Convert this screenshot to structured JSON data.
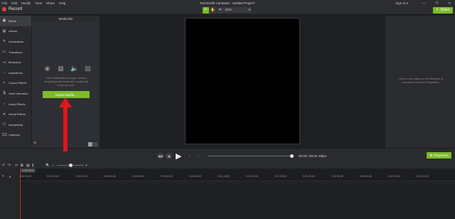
{
  "menubar": {
    "items": [
      "File",
      "Edit",
      "Modify",
      "View",
      "Share",
      "Help"
    ],
    "window_title": "TechSmith Camtasia - Untitled Project*",
    "sign_in": "Sign in ▾",
    "min_glyph": "—",
    "max_glyph": "❐",
    "close_glyph": "✕"
  },
  "toolbar": {
    "record_label": "Record",
    "zoom_value": "63%",
    "share_label": "Share"
  },
  "nav": {
    "items": [
      {
        "label": "Media",
        "icon": "▣"
      },
      {
        "label": "Library",
        "icon": "▤"
      },
      {
        "label": "Annotations",
        "icon": "✎"
      },
      {
        "label": "Transitions",
        "icon": "▭"
      },
      {
        "label": "Behaviors",
        "icon": "↝"
      },
      {
        "label": "Animations",
        "icon": "→"
      },
      {
        "label": "Cursor Effects",
        "icon": "↖"
      },
      {
        "label": "Voice Narration",
        "icon": "🎙"
      },
      {
        "label": "Audio Effects",
        "icon": "♪"
      },
      {
        "label": "Visual Effects",
        "icon": "✦"
      },
      {
        "label": "Interactivity",
        "icon": "☐"
      },
      {
        "label": "Captions",
        "icon": "CC"
      }
    ]
  },
  "media_bin": {
    "title": "Media Bin",
    "empty_text": "Your Media Bin is empty. Screen recordings and imported media will show up here.",
    "import_button": "Import Media...",
    "add_glyph": "+"
  },
  "properties": {
    "empty_text": "Click on an object on the timeline or canvas to show its Properties.",
    "button_label": "Properties"
  },
  "playback": {
    "timecode": "00:00 / 00:00",
    "fps": "30fps"
  },
  "timeline": {
    "playhead": "0:00:00;00",
    "ticks": [
      "0:00:00;00",
      "0:00:10;00",
      "0:00:20;00",
      "0:00:30;00",
      "0:00:40;00",
      "0:00:50;00",
      "0:01:00;00",
      "0:01:10;00",
      "0:01:20;00",
      "0:01:30;00",
      "0:01:40;00",
      "0:01:50;00",
      "0:02:00;00",
      "0:02:10;00",
      "0:02:20;00"
    ]
  },
  "colors": {
    "accent": "#7dbb2a",
    "record": "#e2403a",
    "arrow": "#e0161b"
  }
}
